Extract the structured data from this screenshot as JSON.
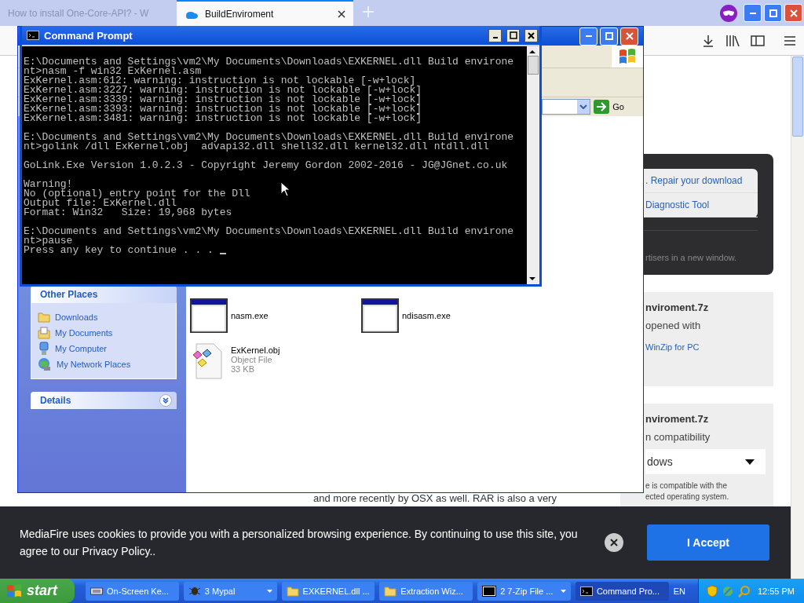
{
  "browser": {
    "tabs": [
      {
        "title": "How to install One-Core-API? - W",
        "selected": false
      },
      {
        "title": "BuildEnviroment",
        "selected": true
      }
    ],
    "page": {
      "repair_rows": [
        ". Repair your download",
        "Diagnostic Tool"
      ],
      "ad_note": "rtisers in a new window.",
      "cards": [
        {
          "kind": "open",
          "title": "nviroment.7z",
          "line": "opened with",
          "link": "WinZip for PC"
        },
        {
          "kind": "compat",
          "title": "nviroment.7z",
          "line": "n compatibility",
          "select": "dows",
          "note": "e is compatible with the\nected operating system."
        }
      ],
      "body_text": "and more recently by OSX as well. RAR is also a very"
    },
    "cookie_banner": {
      "text": "MediaFire uses cookies to provide you with a personalized browsing experience. By continuing to use this site, you agree to our Privacy Policy..",
      "accept": "I Accept"
    }
  },
  "explorer": {
    "go": "Go",
    "other_places": {
      "title": "Other Places",
      "items": [
        {
          "kind": "folder",
          "label": "Downloads"
        },
        {
          "kind": "documents",
          "label": "My Documents"
        },
        {
          "kind": "computer",
          "label": "My Computer"
        },
        {
          "kind": "network",
          "label": "My Network Places"
        }
      ]
    },
    "details": {
      "title": "Details",
      "expanded": false
    },
    "files": [
      {
        "kind": "exe",
        "name": "nasm.exe"
      },
      {
        "kind": "exe",
        "name": "ndisasm.exe"
      },
      {
        "kind": "obj",
        "name": "ExKernel.obj",
        "type": "Object File",
        "size": "33 KB"
      }
    ]
  },
  "console": {
    "title": "Command Prompt",
    "blocks": [
      [
        "E:\\Documents and Settings\\vm2\\My Documents\\Downloads\\EXKERNEL.dll Build environe",
        "nt>nasm -f win32 ExKernel.asm",
        "ExKernel.asm:612: warning: instruction is not lockable [-w+lock]",
        "ExKernel.asm:3227: warning: instruction is not lockable [-w+lock]",
        "ExKernel.asm:3339: warning: instruction is not lockable [-w+lock]",
        "ExKernel.asm:3393: warning: instruction is not lockable [-w+lock]",
        "ExKernel.asm:3481: warning: instruction is not lockable [-w+lock]"
      ],
      [
        "E:\\Documents and Settings\\vm2\\My Documents\\Downloads\\EXKERNEL.dll Build environe",
        "nt>golink /dll ExKernel.obj  advapi32.dll shell32.dll kernel32.dll ntdll.dll"
      ],
      [
        "GoLink.Exe Version 1.0.2.3 - Copyright Jeremy Gordon 2002-2016 - JG@JGnet.co.uk"
      ],
      [
        "Warning!",
        "No (optional) entry point for the Dll",
        "Output file: ExKernel.dll",
        "Format: Win32   Size: 19,968 bytes"
      ],
      [
        "E:\\Documents and Settings\\vm2\\My Documents\\Downloads\\EXKERNEL.dll Build environe",
        "nt>pause",
        "Press any key to continue . . . "
      ]
    ]
  },
  "taskbar": {
    "start": "start",
    "items": [
      {
        "kind": "keyboard",
        "label": "On-Screen Ke...",
        "grouped": false,
        "selected": false
      },
      {
        "kind": "bug",
        "label": "3 Mypal",
        "grouped": true,
        "selected": false
      },
      {
        "kind": "folder",
        "label": "EXKERNEL.dll ...",
        "grouped": false,
        "selected": false
      },
      {
        "kind": "folder",
        "label": "Extraction Wiz...",
        "grouped": false,
        "selected": false
      },
      {
        "kind": "zip",
        "label": "2 7-Zip File ...",
        "grouped": true,
        "selected": false
      },
      {
        "kind": "cmd",
        "label": "Command Pro...",
        "grouped": false,
        "selected": true
      }
    ],
    "language": "EN",
    "clock": "12:55 PM"
  }
}
